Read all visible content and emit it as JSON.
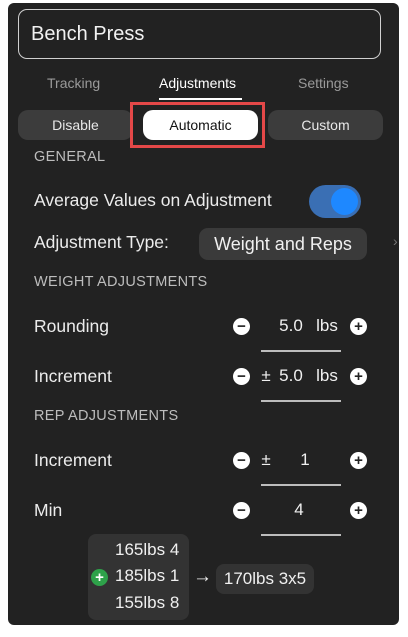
{
  "exercise": {
    "name": "Bench Press"
  },
  "tabs": [
    {
      "label": "Tracking"
    },
    {
      "label": "Adjustments"
    },
    {
      "label": "Settings"
    }
  ],
  "mode": {
    "options": [
      {
        "label": "Disable"
      },
      {
        "label": "Automatic"
      },
      {
        "label": "Custom"
      }
    ],
    "selected": "Automatic"
  },
  "general": {
    "heading": "GENERAL",
    "average_label": "Average Values on Adjustment",
    "average_enabled": true,
    "adjust_type_label": "Adjustment Type:",
    "adjust_type_value": "Weight and Reps"
  },
  "weight": {
    "heading": "WEIGHT ADJUSTMENTS",
    "rounding_label": "Rounding",
    "rounding_value": "5.0",
    "rounding_unit": "lbs",
    "increment_label": "Increment",
    "increment_prefix": "±",
    "increment_value": "5.0",
    "increment_unit": "lbs"
  },
  "reps": {
    "heading": "REP ADJUSTMENTS",
    "increment_label": "Increment",
    "increment_prefix": "±",
    "increment_value": "1",
    "min_label": "Min",
    "min_value": "4"
  },
  "example": {
    "lines": [
      "165lbs 4",
      "185lbs 1",
      "155lbs 8"
    ],
    "result": "170lbs 3x5"
  },
  "colors": {
    "background": "#222222",
    "toggle_on": "#1e88ff",
    "highlight": "#e44848",
    "add_green": "#2ea24a"
  }
}
